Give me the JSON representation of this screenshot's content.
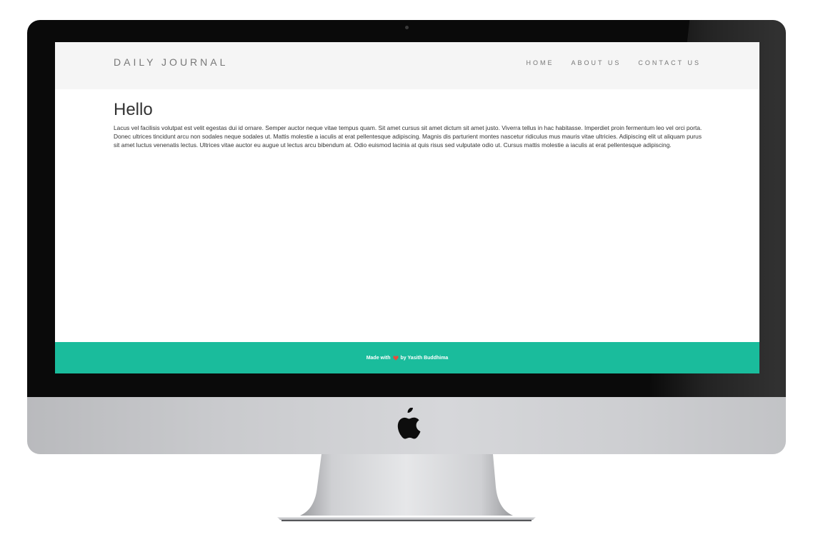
{
  "site": {
    "brand": "DAILY JOURNAL",
    "nav": [
      {
        "label": "HOME"
      },
      {
        "label": "ABOUT US"
      },
      {
        "label": "CONTACT US"
      }
    ]
  },
  "post": {
    "title": "Hello",
    "body": "Lacus vel facilisis volutpat est velit egestas dui id ornare. Semper auctor neque vitae tempus quam. Sit amet cursus sit amet dictum sit amet justo. Viverra tellus in hac habitasse. Imperdiet proin fermentum leo vel orci porta. Donec ultrices tincidunt arcu non sodales neque sodales ut. Mattis molestie a iaculis at erat pellentesque adipiscing. Magnis dis parturient montes nascetur ridiculus mus mauris vitae ultricies. Adipiscing elit ut aliquam purus sit amet luctus venenatis lectus. Ultrices vitae auctor eu augue ut lectus arcu bibendum at. Odio euismod lacinia at quis risus sed vulputate odio ut. Cursus mattis molestie a iaculis at erat pellentesque adipiscing."
  },
  "footer": {
    "prefix": "Made with",
    "icon": "heart-icon",
    "suffix": "by Yasith Buddhima"
  },
  "colors": {
    "navbar_bg": "#f5f5f5",
    "footer_bg": "#1abc9c",
    "heart": "#e74c3c",
    "text": "#333333",
    "nav_text": "#777777"
  }
}
